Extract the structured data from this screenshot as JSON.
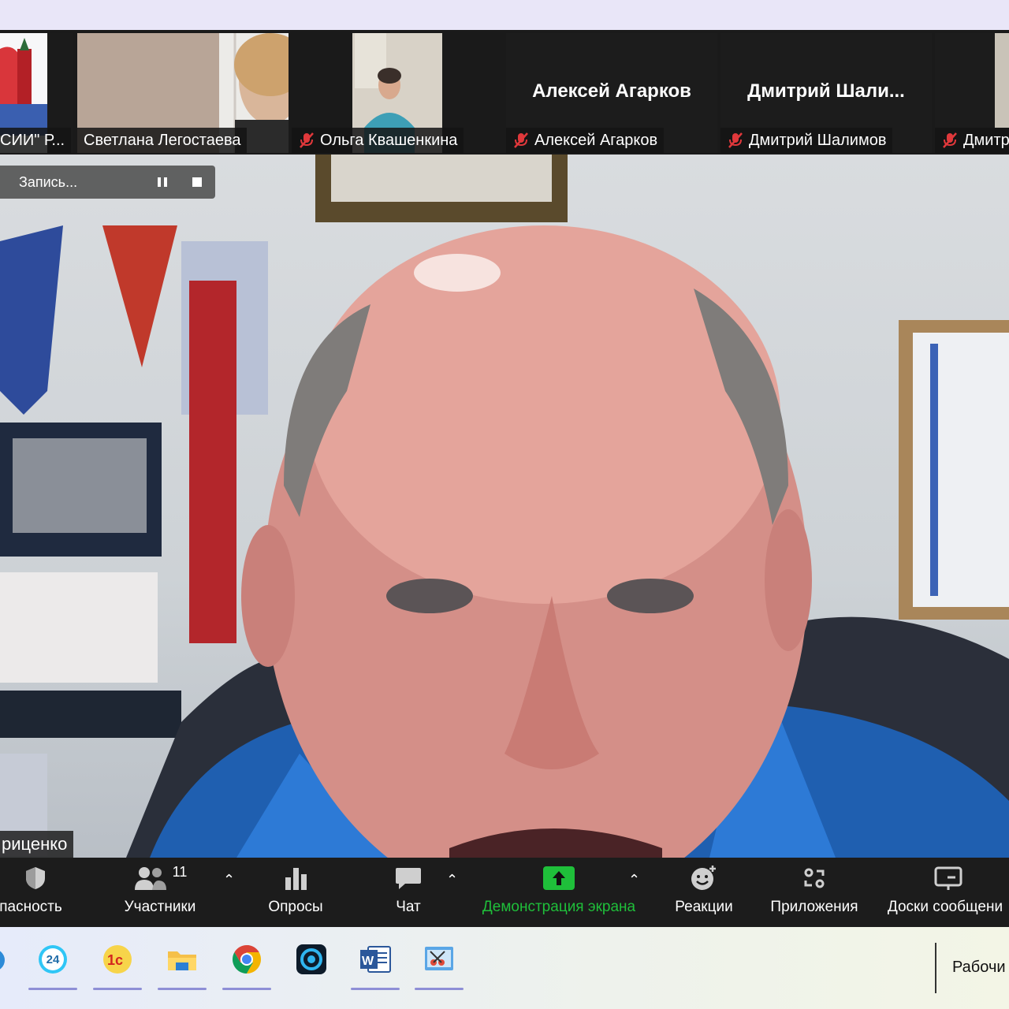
{
  "participants": [
    {
      "label": "СИИ\" Р...",
      "muted": false
    },
    {
      "label": "Светлана Легостаева",
      "muted": false
    },
    {
      "label": "Ольга Квашенкина",
      "muted": true
    },
    {
      "label": "Алексей Агарков",
      "display_name": "Алексей Агарков",
      "muted": true
    },
    {
      "label": "Дмитрий Шалимов",
      "display_name": "Дмитрий  Шали...",
      "muted": true
    },
    {
      "label": "Дмитр",
      "muted": true
    }
  ],
  "recording": {
    "label": "Запись..."
  },
  "speaker": {
    "name": "риценко"
  },
  "toolbar": {
    "security": "пасность",
    "participants": "Участники",
    "participants_count": "11",
    "polls": "Опросы",
    "chat": "Чат",
    "share": "Демонстрация экрана",
    "reactions": "Реакции",
    "apps": "Приложения",
    "whiteboards": "Доски сообщени"
  },
  "taskbar": {
    "apps": [
      "bitrix24-icon",
      "1c-icon",
      "file-explorer-icon",
      "chrome-icon",
      "camera-app-icon",
      "word-icon",
      "snipping-tool-icon"
    ],
    "bitrix_badge": "24",
    "desktop_label": "Рабочи"
  },
  "colors": {
    "share_green": "#1fbf3a",
    "mute_red": "#e0383b",
    "taskbar_underline": "#8e8fd6"
  }
}
